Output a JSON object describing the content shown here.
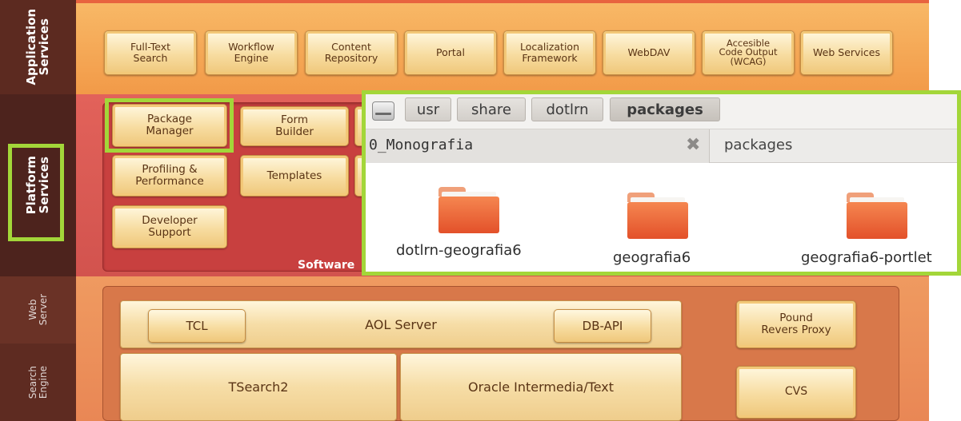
{
  "sidebar": {
    "application": [
      "Application",
      "Services"
    ],
    "platform": [
      "Platform",
      "Services"
    ],
    "web": [
      "Web",
      "Server"
    ],
    "search": [
      "Search",
      "Engine"
    ]
  },
  "application_services": [
    "Full-Text\nSearch",
    "Workflow\nEngine",
    "Content\nRepository",
    "Portal",
    "Localization\nFramework",
    "WebDAV",
    "Accesible\nCode Output\n(WCAG)",
    "Web Services"
  ],
  "platform_services": {
    "package_manager": "Package\nManager",
    "form_builder": "Form\nBuilder",
    "profiling": "Profiling &\nPerformance",
    "templates": "Templates",
    "developer_support": "Developer\nSupport",
    "footer_label": "Software"
  },
  "web_server": {
    "tcl": "TCL",
    "aol_server": "AOL Server",
    "db_api": "DB-API",
    "pound": "Pound\nRevers Proxy"
  },
  "search_engine": {
    "tsearch": "TSearch2",
    "oracle": "Oracle Intermedia/Text",
    "cvs": "CVS"
  },
  "file_manager": {
    "breadcrumbs": [
      "usr",
      "share",
      "dotlrn",
      "packages"
    ],
    "left_tab": "0_Monografia",
    "right_tab": "packages",
    "folders": [
      "dotlrn-geografia6",
      "geografia6",
      "geografia6-portlet"
    ]
  },
  "colors": {
    "highlight": "#a3d639",
    "folder": "#e3512a",
    "app_band": "#f6a455",
    "platform_band": "#d95b56",
    "server_band": "#e98755"
  }
}
